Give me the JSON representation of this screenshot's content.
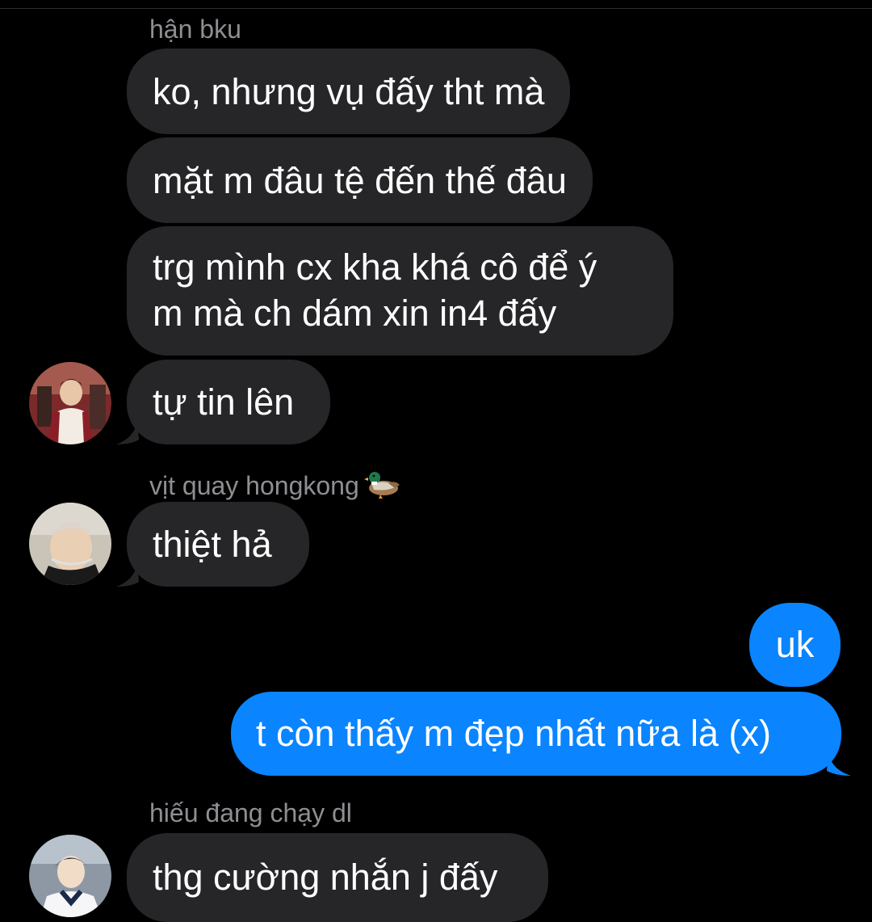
{
  "chat": {
    "groups": [
      {
        "sender": "hận bku",
        "messages": [
          "ko, nhưng vụ đấy tht mà",
          "mặt m đâu tệ đến thế đâu",
          "trg mình cx kha khá cô để ý",
          "m mà ch dám xin in4 đấy",
          "tự tin lên"
        ]
      },
      {
        "sender": "vịt quay hongkong",
        "sender_emoji": "duck-emoji",
        "messages": [
          "thiệt hả"
        ]
      },
      {
        "sender": "hiếu đang chạy dl",
        "messages": [
          "thg cường nhắn j đấy"
        ]
      }
    ],
    "outgoing": [
      "uk",
      "t còn thấy m đẹp nhất nữa là (x)"
    ]
  },
  "colors": {
    "background": "#000000",
    "incoming_bubble": "#262628",
    "outgoing_bubble": "#0a84ff",
    "sender_name": "#8e8e93"
  }
}
